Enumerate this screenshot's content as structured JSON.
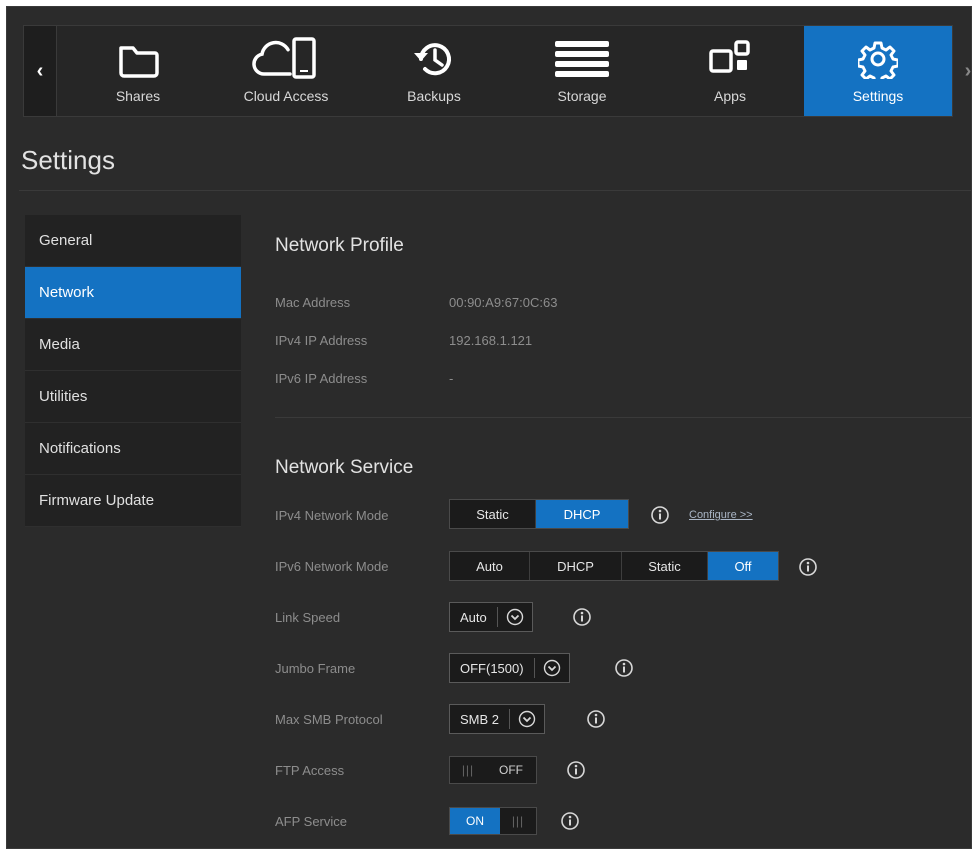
{
  "nav": {
    "items": [
      {
        "label": "Shares",
        "icon": "folder-icon"
      },
      {
        "label": "Cloud Access",
        "icon": "cloud-device-icon"
      },
      {
        "label": "Backups",
        "icon": "history-icon"
      },
      {
        "label": "Storage",
        "icon": "storage-icon"
      },
      {
        "label": "Apps",
        "icon": "apps-icon"
      },
      {
        "label": "Settings",
        "icon": "gear-icon"
      }
    ],
    "prev_label": "‹",
    "next_label": "›"
  },
  "page": {
    "title": "Settings"
  },
  "sidebar": {
    "items": [
      {
        "label": "General"
      },
      {
        "label": "Network"
      },
      {
        "label": "Media"
      },
      {
        "label": "Utilities"
      },
      {
        "label": "Notifications"
      },
      {
        "label": "Firmware Update"
      }
    ],
    "selected": "Network"
  },
  "profile": {
    "title": "Network Profile",
    "rows": [
      {
        "label": "Mac Address",
        "value": "00:90:A9:67:0C:63"
      },
      {
        "label": "IPv4 IP Address",
        "value": "192.168.1.121"
      },
      {
        "label": "IPv6 IP Address",
        "value": "-"
      }
    ]
  },
  "service": {
    "title": "Network Service",
    "ipv4": {
      "label": "IPv4 Network Mode",
      "options": [
        "Static",
        "DHCP"
      ],
      "selected": "DHCP",
      "configure_link": "Configure >>"
    },
    "ipv6": {
      "label": "IPv6 Network Mode",
      "options": [
        "Auto",
        "DHCP",
        "Static",
        "Off"
      ],
      "selected": "Off"
    },
    "link_speed": {
      "label": "Link Speed",
      "value": "Auto"
    },
    "jumbo_frame": {
      "label": "Jumbo Frame",
      "value": "OFF(1500)"
    },
    "max_smb": {
      "label": "Max SMB Protocol",
      "value": "SMB 2"
    },
    "ftp": {
      "label": "FTP Access",
      "state": "OFF"
    },
    "afp": {
      "label": "AFP Service",
      "state": "ON"
    }
  },
  "colors": {
    "accent": "#1472c2",
    "background": "#2b2b2b",
    "sidebar": "#222222"
  }
}
